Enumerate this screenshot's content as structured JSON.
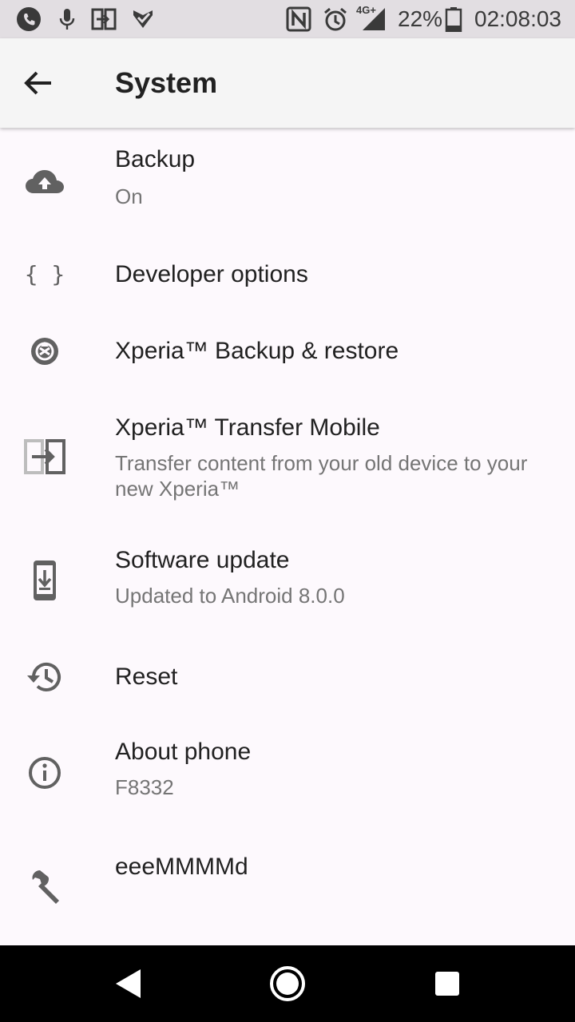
{
  "status_bar": {
    "battery": "22%",
    "time": "02:08:03",
    "network": "4G+",
    "icons": [
      "call-icon",
      "mic-icon",
      "transfer-icon",
      "task-icon",
      "nfc-icon",
      "alarm-icon",
      "signal-icon",
      "battery-icon"
    ]
  },
  "app_bar": {
    "title": "System",
    "back_icon": "arrow-back-icon"
  },
  "items": [
    {
      "icon": "cloud-upload-icon",
      "title": "Backup",
      "subtitle": "On"
    },
    {
      "icon": "braces-icon",
      "title": "Developer options",
      "subtitle": "",
      "icon_text": "{ }"
    },
    {
      "icon": "xperia-backup-icon",
      "title": "Xperia™ Backup & restore",
      "subtitle": ""
    },
    {
      "icon": "transfer-icon",
      "title": "Xperia™ Transfer Mobile",
      "subtitle": "Transfer content from your old device to your new Xperia™"
    },
    {
      "icon": "system-update-icon",
      "title": "Software update",
      "subtitle": "Updated to Android 8.0.0"
    },
    {
      "icon": "history-icon",
      "title": "Reset",
      "subtitle": ""
    },
    {
      "icon": "info-icon",
      "title": "About phone",
      "subtitle": "F8332"
    },
    {
      "icon": "wrench-icon",
      "title": "eeeMMMMd",
      "subtitle": ""
    }
  ],
  "nav_bar": {
    "back": "nav-back-icon",
    "home": "nav-home-icon",
    "recents": "nav-recents-icon"
  },
  "colors": {
    "status_bg": "#e2dee2",
    "appbar_bg": "#f5f5f5",
    "list_bg": "#fdf9fd",
    "primary_text": "#212121",
    "secondary_text": "#757575",
    "icon": "#616161"
  }
}
